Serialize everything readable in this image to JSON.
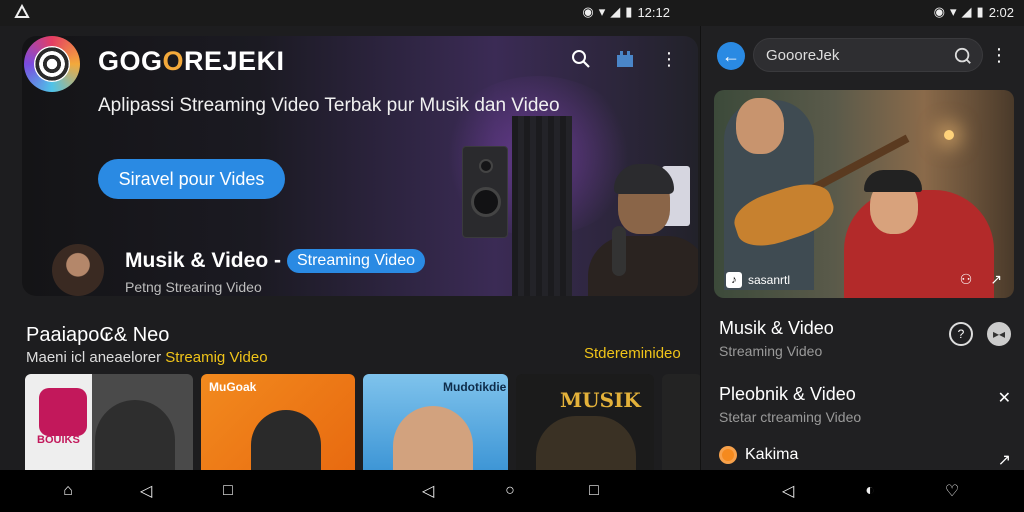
{
  "status_left": {
    "time": "12:12"
  },
  "status_right": {
    "time": "2:02"
  },
  "header": {
    "brand_pre": "GOG",
    "brand_o": "O",
    "brand_post": "REJEKI",
    "tagline": "Aplipassi Streaming Video Terbak pur Musik dan Video",
    "cta_label": "Siravel pour Vides"
  },
  "featured": {
    "title": "Musik & Video -",
    "pill": "Streaming Video",
    "subtitle": "Petng  Strearing Video"
  },
  "section": {
    "title": "Paaiapo₢& Neo",
    "subtitle_prefix": "Maeni icl aneaelorer ",
    "subtitle_highlight": "Streamig Video",
    "right_link": "Stdereminideo"
  },
  "thumbnails": [
    {
      "label": "BOUIKS"
    },
    {
      "label": "MuGoak"
    },
    {
      "label": "Mudotikdie"
    },
    {
      "label": "MUSIK"
    },
    {
      "label": ""
    }
  ],
  "right_pane": {
    "search_value": "GoooreJek",
    "video_channel": "sasanrtl",
    "rows": [
      {
        "title": "Musik & Video",
        "subtitle": "Streaming Video"
      },
      {
        "title": "Pleobnik & Video",
        "subtitle": "Stetar ctreaming Video"
      },
      {
        "title": "Kakima",
        "subtitle": ""
      }
    ]
  },
  "colors": {
    "accent": "#2a8ae3",
    "highlight": "#f0c419",
    "brand_o": "#f3a93b",
    "background": "#1c1c1e"
  },
  "icons": {
    "search": "search-icon",
    "cast": "cast-icon",
    "menu": "more-vert-icon",
    "back": "back-arrow-icon",
    "home": "home-icon",
    "nav_back": "nav-back-icon",
    "recents": "recents-icon"
  }
}
